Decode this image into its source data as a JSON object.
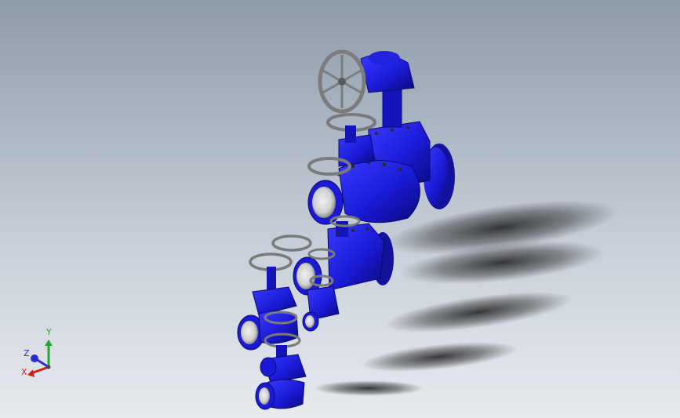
{
  "viewport": {
    "colors": {
      "background_top": "#8e9bab",
      "background_bottom": "#e7ebef",
      "valve_body": "#1a1ad6",
      "valve_dark": "#0a0a7a",
      "handwheel": "#8a8a8a",
      "bolt": "#3a3a3a",
      "bore": "#d9d9d9"
    },
    "model": {
      "name": "gate-valve-series-assembly",
      "valve_count": 6,
      "has_gear_operator": true
    }
  },
  "triad": {
    "x_label": "X",
    "y_label": "Y",
    "z_label": "Z",
    "x_color": "#d21c1c",
    "y_color": "#22a82a",
    "z_color": "#2a2ad2"
  }
}
